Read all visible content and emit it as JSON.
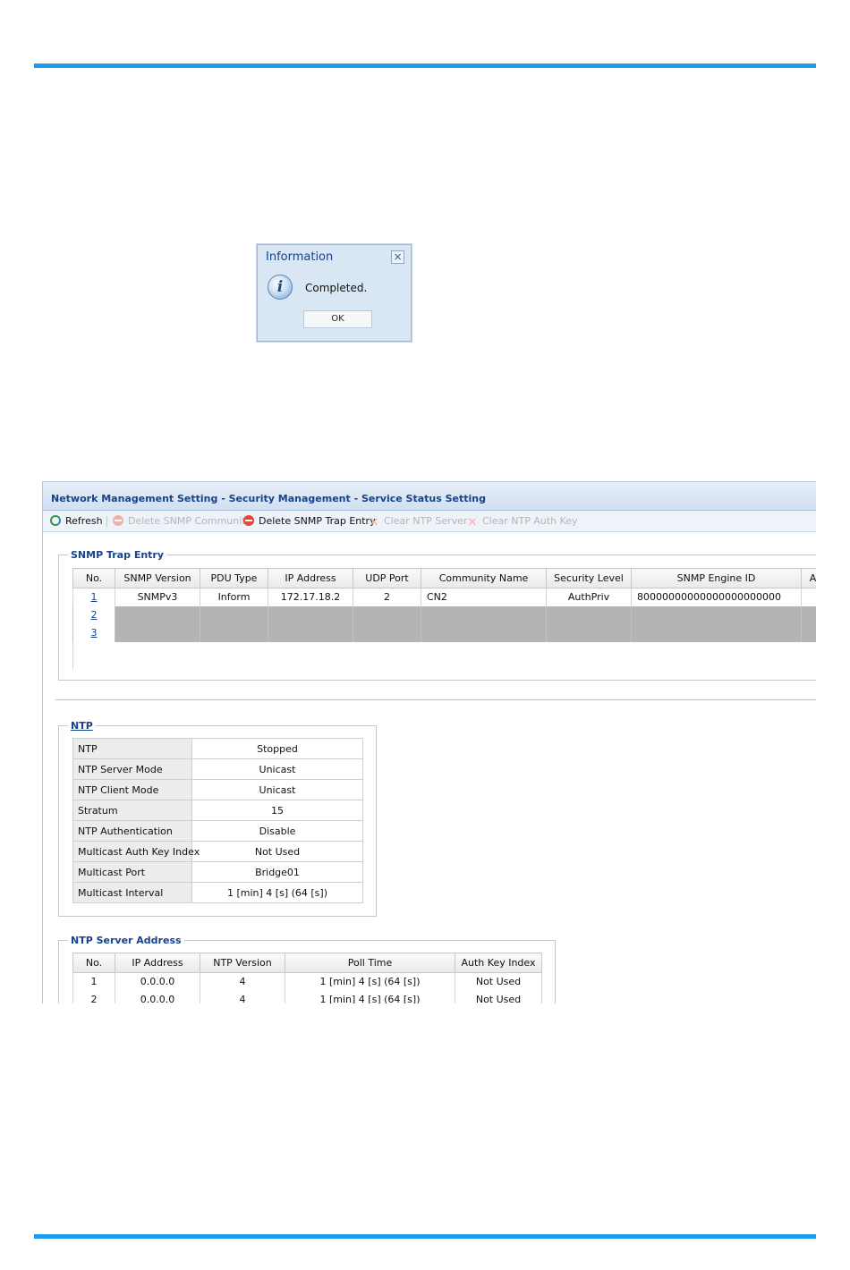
{
  "dialog": {
    "title": "Information",
    "message": "Completed.",
    "ok_label": "OK",
    "close_label": "×",
    "info_glyph": "i",
    "icon": "info-icon"
  },
  "panel": {
    "title": "Network Management Setting - Security Management - Service Status Setting"
  },
  "toolbar": {
    "refresh": "Refresh",
    "delete_snmp_community": "Delete SNMP Community",
    "delete_snmp_trap_entry": "Delete SNMP Trap Entry",
    "clear_ntp_server": "Clear NTP Server",
    "clear_ntp_auth_key": "Clear NTP Auth Key"
  },
  "snmp_trap": {
    "legend": "SNMP Trap Entry",
    "columns": [
      "No.",
      "SNMP Version",
      "PDU Type",
      "IP Address",
      "UDP Port",
      "Community Name",
      "Security Level",
      "SNMP Engine ID",
      "A"
    ],
    "rows": [
      {
        "no": "1",
        "version": "SNMPv3",
        "pdu": "Inform",
        "ip": "172.17.18.2",
        "port": "2",
        "community": "CN2",
        "security": "AuthPriv",
        "engine_id": "80000000000000000000000"
      },
      {
        "no": "2"
      },
      {
        "no": "3"
      }
    ]
  },
  "ntp": {
    "legend": "NTP",
    "rows": [
      {
        "key": "NTP",
        "value": "Stopped"
      },
      {
        "key": "NTP Server Mode",
        "value": "Unicast"
      },
      {
        "key": "NTP Client Mode",
        "value": "Unicast"
      },
      {
        "key": "Stratum",
        "value": "15"
      },
      {
        "key": "NTP Authentication",
        "value": "Disable"
      },
      {
        "key": "Multicast Auth Key Index",
        "value": "Not Used"
      },
      {
        "key": "Multicast Port",
        "value": "Bridge01"
      },
      {
        "key": "Multicast Interval",
        "value": "1 [min] 4 [s] (64 [s])"
      }
    ]
  },
  "ntp_server": {
    "legend": "NTP Server Address",
    "columns": [
      "No.",
      "IP Address",
      "NTP Version",
      "Poll Time",
      "Auth Key Index"
    ],
    "rows": [
      {
        "no": "1",
        "ip": "0.0.0.0",
        "version": "4",
        "poll": "1 [min] 4 [s] (64 [s])",
        "auth": "Not Used"
      },
      {
        "no": "2",
        "ip": "0.0.0.0",
        "version": "4",
        "poll": "1 [min] 4 [s] (64 [s])",
        "auth": "Not Used"
      }
    ]
  },
  "colors": {
    "rule": "#1e9be9",
    "title_blue": "#15428b",
    "empty_row": "#b4b4b4"
  }
}
